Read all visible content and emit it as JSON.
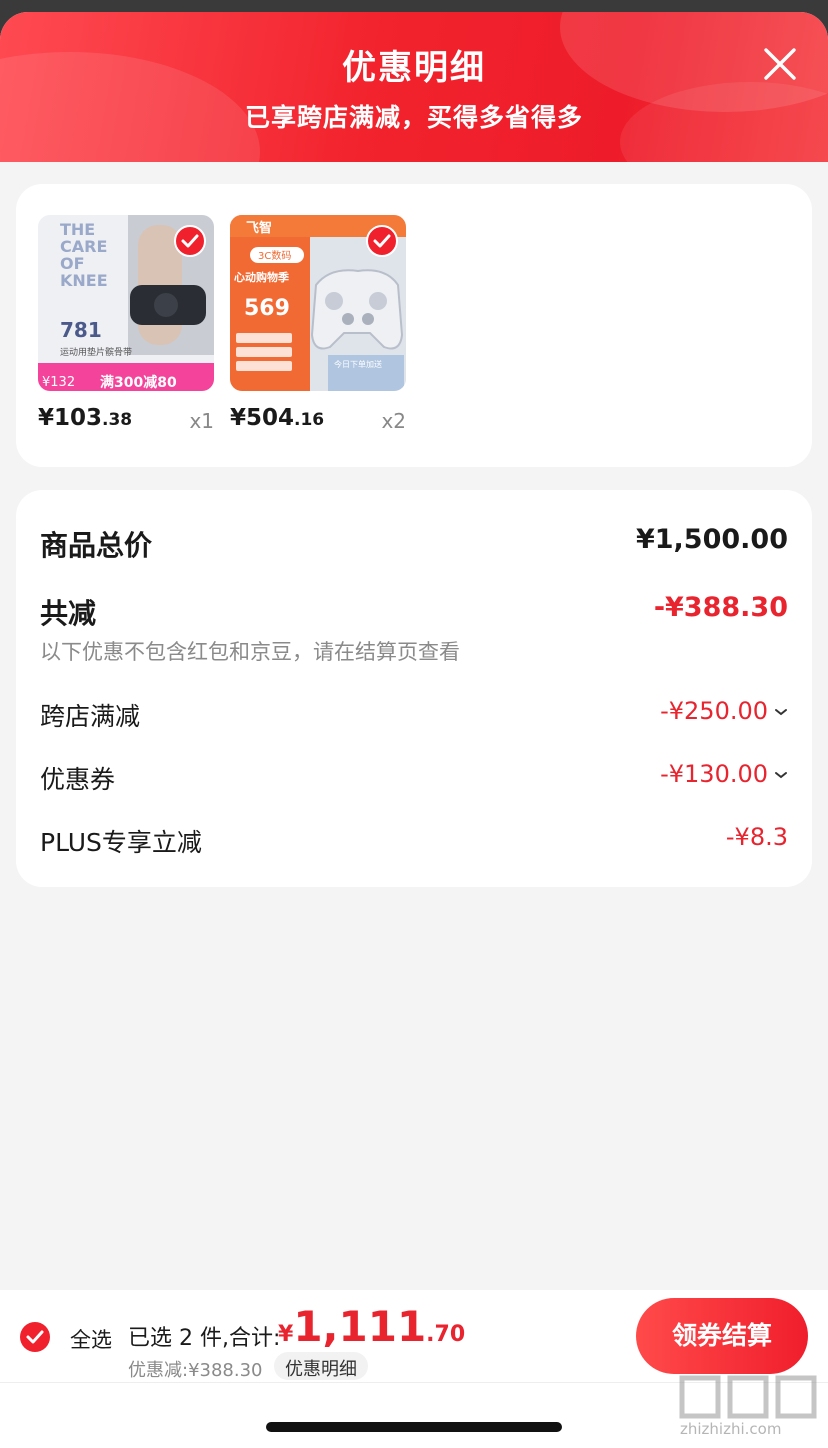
{
  "header": {
    "title": "优惠明细",
    "subtitle": "已享跨店满减，买得多省得多",
    "close_icon": "close-icon"
  },
  "products": [
    {
      "name": "knee-support",
      "image": {
        "line1": "THE",
        "line2": "CARE",
        "line3": "OF",
        "line4": "KNEE",
        "num": "781",
        "caption": "运动用垫片髌骨带",
        "tag": "满300减80",
        "small_price": "¥132"
      },
      "price_int": "¥103",
      "price_dec": ".38",
      "qty": "x1",
      "selected": true
    },
    {
      "name": "game-controller",
      "image": {
        "brand": "飞智",
        "tag": "3C数码",
        "slogan": "心动购物季",
        "price": "569",
        "badge": "今日下单加送"
      },
      "price_int": "¥504",
      "price_dec": ".16",
      "qty": "x2",
      "selected": true
    }
  ],
  "summary": {
    "total_label": "商品总价",
    "total_value": "¥1,500.00",
    "discount_label": "共减",
    "discount_value": "-¥388.30",
    "note": "以下优惠不包含红包和京豆，请在结算页查看",
    "items": [
      {
        "label": "跨店满减",
        "value": "-¥250.00",
        "expandable": true
      },
      {
        "label": "优惠券",
        "value": "-¥130.00",
        "expandable": true
      },
      {
        "label": "PLUS专享立减",
        "value": "-¥8.3",
        "expandable": false
      }
    ]
  },
  "bottom": {
    "select_all": "全选",
    "selected_text": "已选 2 件,合计:",
    "total_yen": "¥",
    "total_int": "1,111",
    "total_dec": ".70",
    "saved": "优惠减:¥388.30",
    "detail_tag": "优惠明细",
    "checkout": "领券结算"
  },
  "watermark": "zhizhizhi.com",
  "colors": {
    "accent": "#f0212d",
    "price_red": "#e8242f"
  }
}
